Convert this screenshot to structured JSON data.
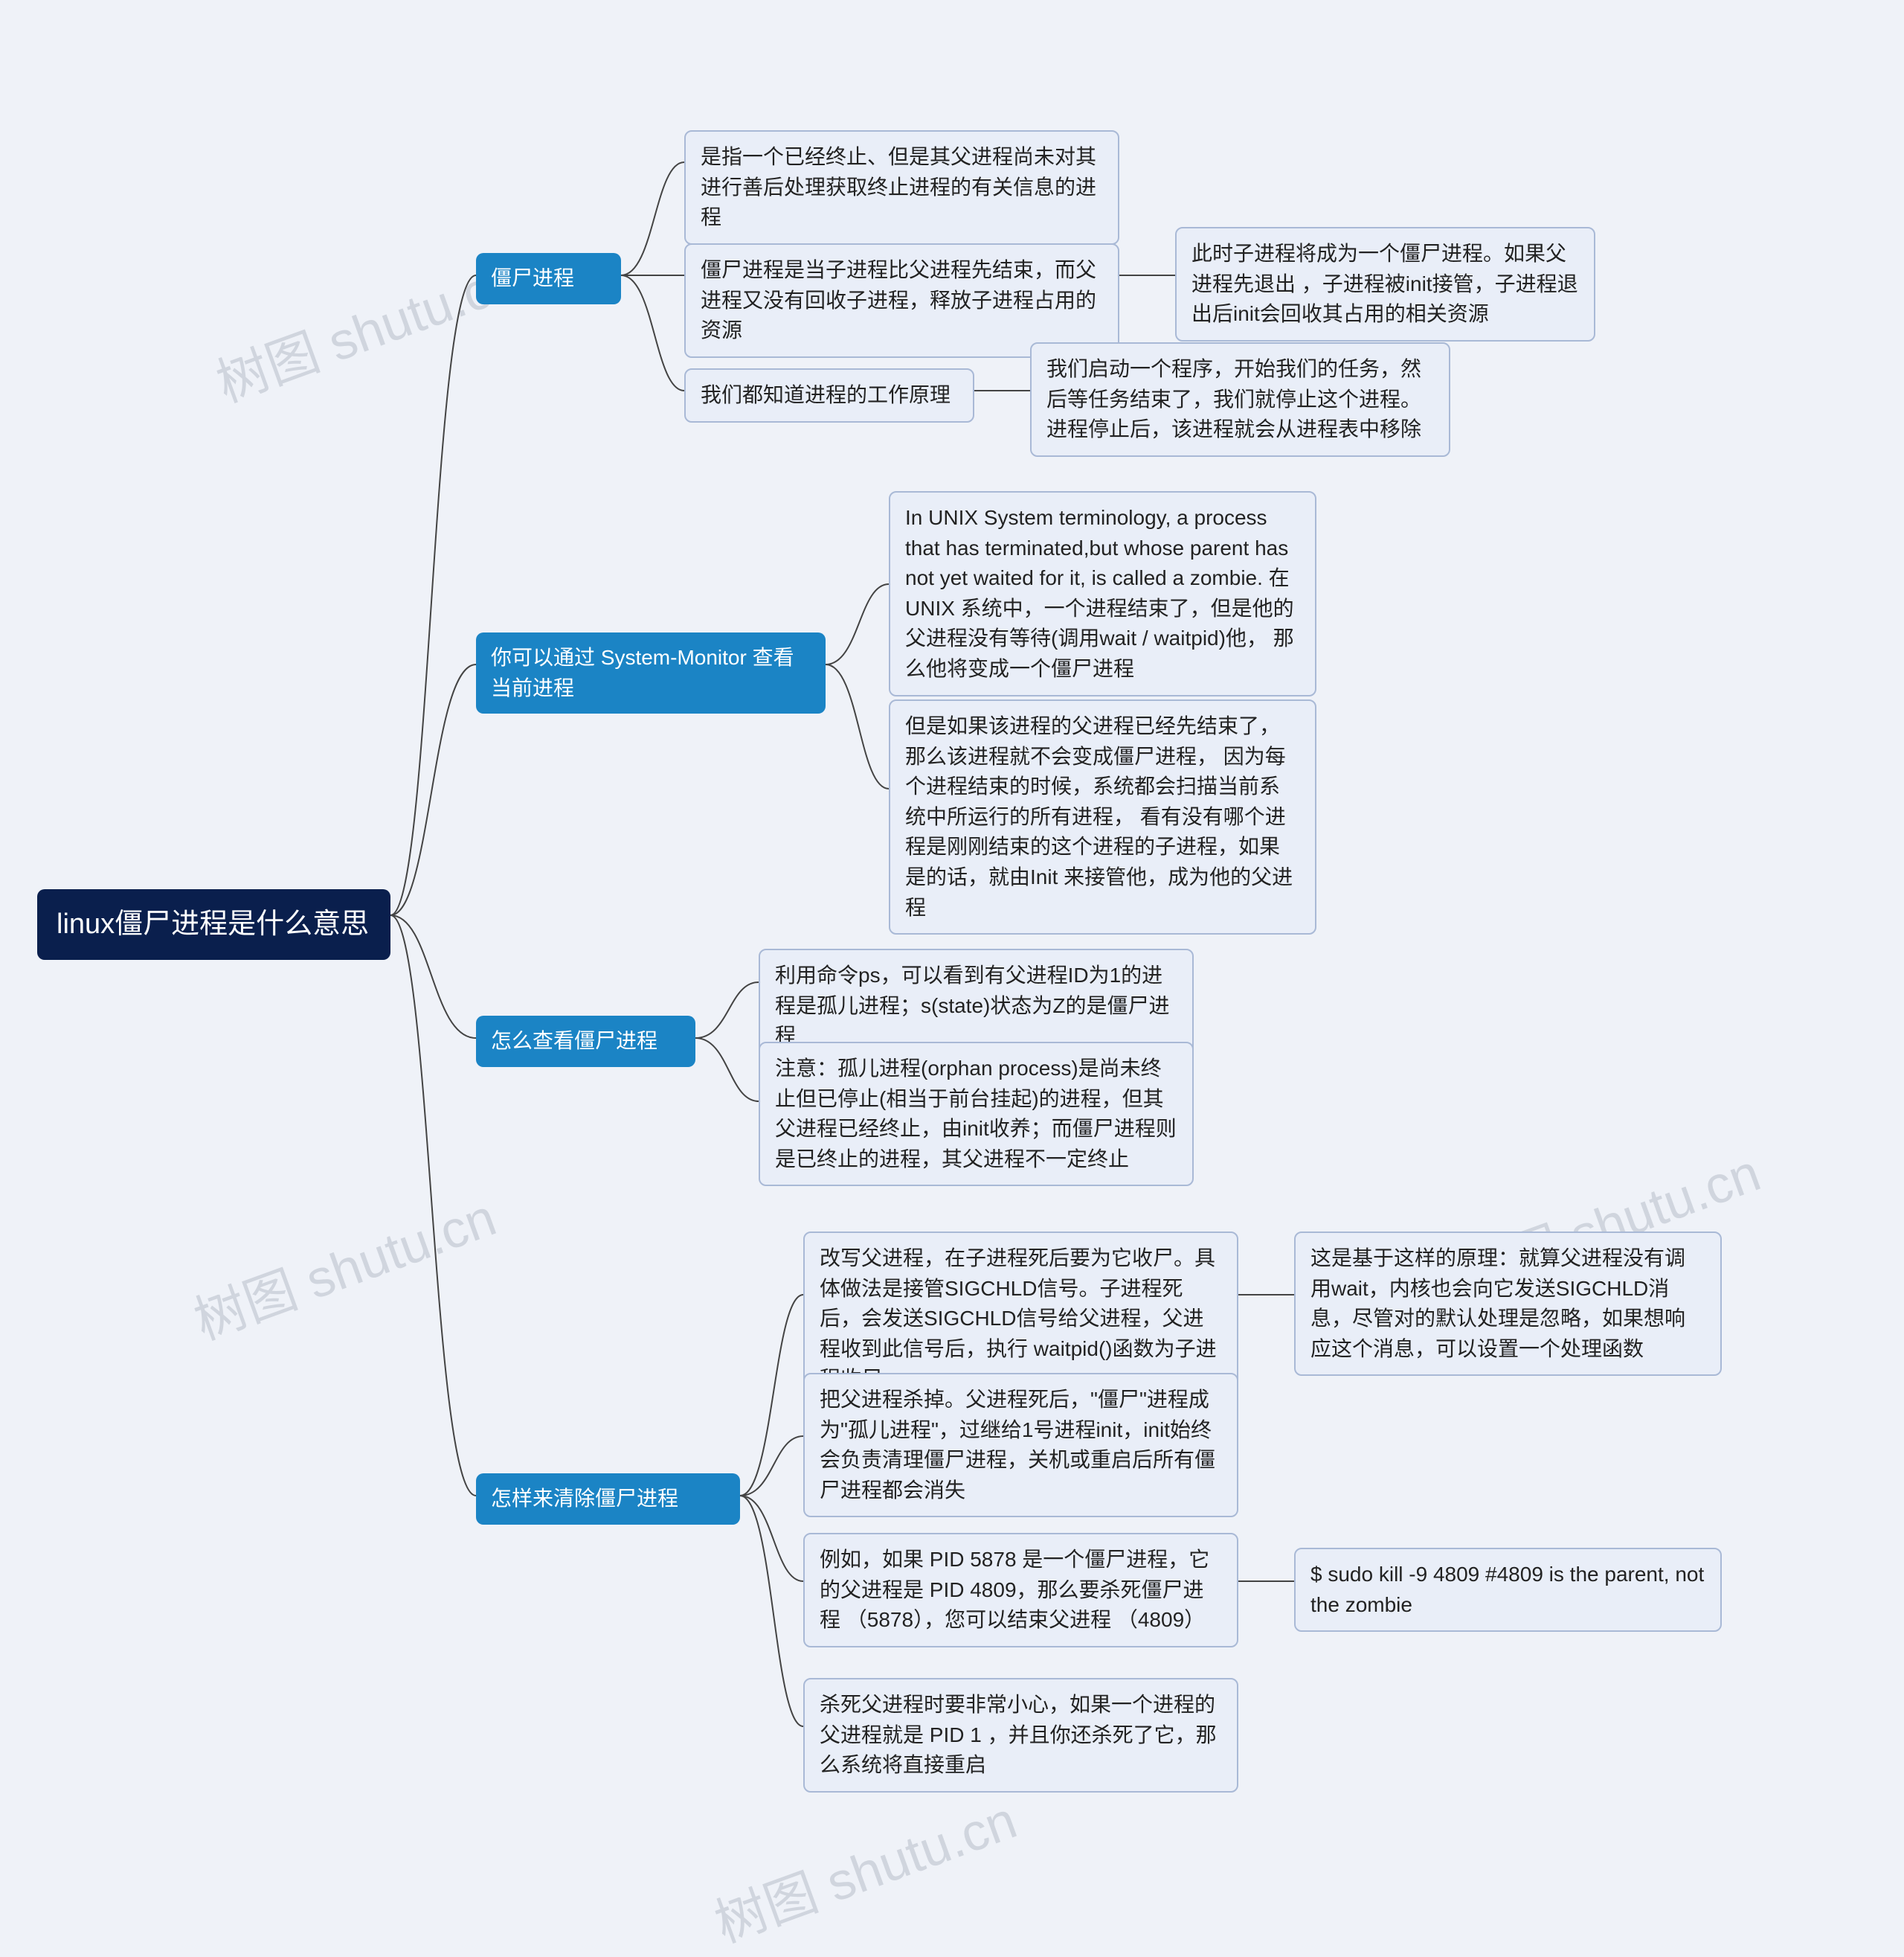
{
  "root": {
    "label": "linux僵尸进程是什么意思"
  },
  "branches": {
    "b1": {
      "label": "僵尸进程"
    },
    "b2": {
      "label": "你可以通过 System-Monitor 查看当前进程"
    },
    "b3": {
      "label": "怎么查看僵尸进程"
    },
    "b4": {
      "label": "怎样来清除僵尸进程"
    }
  },
  "leaves": {
    "b1c1": "是指一个已经终止、但是其父进程尚未对其进行善后处理获取终止进程的有关信息的进程",
    "b1c2": "僵尸进程是当子进程比父进程先结束，而父进程又没有回收子进程，释放子进程占用的资源",
    "b1c2a": "此时子进程将成为一个僵尸进程。如果父进程先退出 ，子进程被init接管，子进程退出后init会回收其占用的相关资源",
    "b1c3": "我们都知道进程的工作原理",
    "b1c3a": "我们启动一个程序，开始我们的任务，然后等任务结束了，我们就停止这个进程。进程停止后，该进程就会从进程表中移除",
    "b2c1": "In UNIX System terminology, a process that has terminated,but whose parent has not yet waited for it, is called a zombie. 在UNIX 系统中，一个进程结束了，但是他的父进程没有等待(调用wait / waitpid)他， 那么他将变成一个僵尸进程",
    "b2c2": "但是如果该进程的父进程已经先结束了，那么该进程就不会变成僵尸进程， 因为每个进程结束的时候，系统都会扫描当前系统中所运行的所有进程， 看有没有哪个进程是刚刚结束的这个进程的子进程，如果是的话，就由Init 来接管他，成为他的父进程",
    "b3c1": "利用命令ps，可以看到有父进程ID为1的进程是孤儿进程；s(state)状态为Z的是僵尸进程",
    "b3c2": "注意：孤儿进程(orphan process)是尚未终止但已停止(相当于前台挂起)的进程，但其父进程已经终止，由init收养；而僵尸进程则是已终止的进程，其父进程不一定终止",
    "b4c1": "改写父进程，在子进程死后要为它收尸。具体做法是接管SIGCHLD信号。子进程死后，会发送SIGCHLD信号给父进程，父进程收到此信号后，执行 waitpid()函数为子进程收尸",
    "b4c1a": "这是基于这样的原理：就算父进程没有调用wait，内核也会向它发送SIGCHLD消息，尽管对的默认处理是忽略，如果想响应这个消息，可以设置一个处理函数",
    "b4c2": "把父进程杀掉。父进程死后，\"僵尸\"进程成为\"孤儿进程\"，过继给1号进程init，init始终会负责清理僵尸进程，关机或重启后所有僵尸进程都会消失",
    "b4c3": "例如，如果 PID 5878 是一个僵尸进程，它的父进程是 PID 4809，那么要杀死僵尸进程 （5878），您可以结束父进程 （4809）",
    "b4c3a": "$ sudo kill -9 4809  #4809 is the parent, not the zombie",
    "b4c4": "杀死父进程时要非常小心，如果一个进程的父进程就是 PID 1 ，并且你还杀死了它，那么系统将直接重启"
  },
  "watermark": "树图 shutu.cn"
}
